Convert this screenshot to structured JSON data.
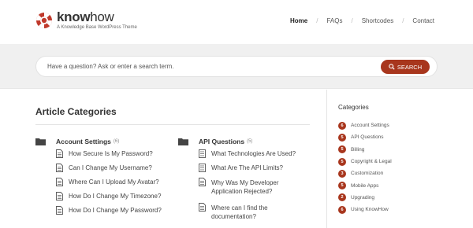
{
  "header": {
    "brand_bold": "know",
    "brand_light": "how",
    "tagline": "A Knowledge Base WordPress Theme",
    "nav": [
      {
        "label": "Home",
        "active": true
      },
      {
        "label": "FAQs",
        "active": false
      },
      {
        "label": "Shortcodes",
        "active": false
      },
      {
        "label": "Contact",
        "active": false
      }
    ],
    "separator": "/"
  },
  "search": {
    "placeholder": "Have a question? Ask or enter a search term.",
    "button_label": "SEARCH"
  },
  "main": {
    "title": "Article Categories",
    "columns": [
      {
        "category": "Account Settings",
        "count": "(6)",
        "articles": [
          [
            "How Secure Is My Password?"
          ],
          [
            "Can I Change My Username?"
          ],
          [
            "Where Can I Upload My Avatar?"
          ],
          [
            "How Do I Change My Timezone?"
          ],
          [
            "How Do I Change My Password?"
          ]
        ]
      },
      {
        "category": "API Questions",
        "count": "(5)",
        "articles": [
          [
            "What Technologies Are Used?"
          ],
          [
            "What Are The API Limits?"
          ],
          [
            "Why Was My Developer",
            "Application Rejected?"
          ],
          [
            "Where can I find the",
            "documentation?"
          ]
        ]
      }
    ]
  },
  "sidebar": {
    "title": "Categories",
    "items": [
      {
        "count": "6",
        "label": "Account Settings"
      },
      {
        "count": "5",
        "label": "API Questions"
      },
      {
        "count": "5",
        "label": "Billing"
      },
      {
        "count": "5",
        "label": "Copyright & Legal"
      },
      {
        "count": "3",
        "label": "Customization"
      },
      {
        "count": "5",
        "label": "Mobile Apps"
      },
      {
        "count": "2",
        "label": "Upgrading"
      },
      {
        "count": "6",
        "label": "Using KnowHow"
      }
    ]
  },
  "colors": {
    "accent": "#a8361d",
    "band": "#f0f0f0",
    "text": "#333333"
  }
}
